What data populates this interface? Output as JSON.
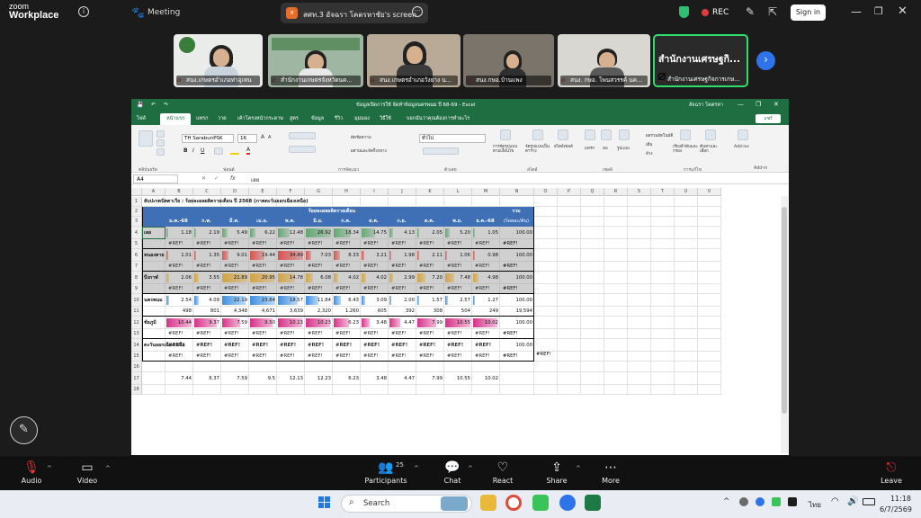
{
  "zoom": {
    "logo_line1": "zoom",
    "logo_line2": "Workplace",
    "meeting_label": "Meeting",
    "share_avatar": "ส",
    "share_label": "สศท.3 อัจฉรา โคตรหาชัย's screen",
    "rec_label": "REC",
    "signin_label": "Sign in",
    "participants": [
      {
        "name": "สนง.เกษตรอำเภอท่าอุเทน"
      },
      {
        "name": "สำนักงานเกษตรจังหวัดนค..."
      },
      {
        "name": "สนง.เกษตรอำเภอวังยาง น..."
      },
      {
        "name": "สนง.กษอ.บ้านแพง"
      },
      {
        "name": "สนง. กษอ. โพนสวรรค์ นค..."
      },
      {
        "name": "สำนักงานเศรษฐกิจการเกษ..."
      }
    ],
    "active_tile_title": "สำนักงานเศรษฐกิ...",
    "toolbar": {
      "audio": "Audio",
      "video": "Video",
      "participants": "Participants",
      "participants_count": "25",
      "chat": "Chat",
      "react": "React",
      "share": "Share",
      "more": "More",
      "leave": "Leave"
    }
  },
  "excel": {
    "title": "ข้อมูลเปิดการใช้ จัดทำข้อมูลนครพนม ปี 68-69 - Excel",
    "user": "อัจฉรา โคตรหา",
    "tabs": [
      "ไฟล์",
      "หน้าแรก",
      "แทรก",
      "วาด",
      "เค้าโครงหน้ากระดาษ",
      "สูตร",
      "ข้อมูล",
      "รีวิว",
      "มุมมอง",
      "วิธีใช้",
      "บอกฉันว่าคุณต้องการทำอะไร"
    ],
    "share_label": "แชร์",
    "ribbon": {
      "font_name": "TH SarabunPSK",
      "font_size": "16",
      "number_format": "ทั่วไป",
      "groups": [
        "คลิปบอร์ด",
        "ฟอนต์",
        "การจัดแนว",
        "ตัวเลข",
        "สไตล์",
        "เซลล์",
        "การแก้ไข",
        "Add-in"
      ],
      "wrap_text": "ตัดข้อความ",
      "merge_center": "ผสานและจัดกึ่งกลาง",
      "cond_format": "การจัดรูปแบบตามเงื่อนไข",
      "format_table": "จัดรูปแบบเป็นตาราง",
      "cell_styles": "สไตล์เซลล์",
      "insert": "แทรก",
      "delete": "ลบ",
      "format": "รูปแบบ",
      "autosum": "ผลรวมอัตโนมัติ",
      "fill": "เติม",
      "clear": "ล้าง",
      "sort_filter": "เรียงลำดับและกรอง",
      "find_select": "ค้นหาและเลือก",
      "addins": "Add-ins"
    },
    "name_box": "A4",
    "formula_value": "เลย",
    "columns": [
      "A",
      "B",
      "C",
      "D",
      "E",
      "F",
      "G",
      "H",
      "I",
      "J",
      "K",
      "L",
      "M",
      "N",
      "O",
      "P",
      "Q",
      "R",
      "S",
      "T",
      "U",
      "V"
    ],
    "sheet_title": "สับปะรดปัตตาเวีย : ร้อยละผลผลิตรายเดือน ปี 2568 (ภาคตะวันออกเฉียงเหนือ)",
    "header_main": "ร้อยละผลผลิตรายเดือน",
    "header_total": "รวม",
    "header_total_sub": "(ร้อยละ/ตัน)",
    "months": [
      "ม.ค.-68",
      "ก.พ.",
      "มี.ค.",
      "เม.ย.",
      "พ.ค.",
      "มิ.ย.",
      "ก.ค.",
      "ส.ค.",
      "ก.ย.",
      "ต.ค.",
      "พ.ย.",
      "ธ.ค.-68"
    ],
    "row_numbers": [
      "1",
      "2",
      "3",
      "4",
      "5",
      "6",
      "7",
      "8",
      "9",
      "10",
      "11",
      "12",
      "13",
      "14",
      "15",
      "16",
      "17",
      "18"
    ],
    "rows": [
      {
        "label": "เลย",
        "values": [
          "1.18",
          "2.19",
          "5.49",
          "6.22",
          "12.48",
          "26.92",
          "18.34",
          "14.75",
          "4.13",
          "2.05",
          "5.20",
          "1.05"
        ],
        "total": "100.00",
        "bar": [
          1.18,
          2.19,
          5.49,
          6.22,
          12.48,
          26.92,
          18.34,
          14.75,
          4.13,
          2.05,
          5.2,
          1.05
        ],
        "color": "#63a874"
      },
      {
        "label": "",
        "values": [
          "#REF!",
          "#REF!",
          "#REF!",
          "#REF!",
          "#REF!",
          "#REF!",
          "#REF!",
          "#REF!",
          "#REF!",
          "#REF!",
          "#REF!",
          "#REF!"
        ],
        "total": "#REF!"
      },
      {
        "label": "หนองคาย",
        "values": [
          "1.01",
          "1.35",
          "9.01",
          "19.44",
          "34.49",
          "7.03",
          "8.33",
          "3.21",
          "1.98",
          "2.11",
          "1.06",
          "0.98"
        ],
        "total": "100.00",
        "bar": [
          1.01,
          1.35,
          9.01,
          19.44,
          34.49,
          7.03,
          8.33,
          3.21,
          1.98,
          2.11,
          1.06,
          0.98
        ],
        "color": "#d9534f"
      },
      {
        "label": "",
        "values": [
          "#REF!",
          "#REF!",
          "#REF!",
          "#REF!",
          "#REF!",
          "#REF!",
          "#REF!",
          "#REF!",
          "#REF!",
          "#REF!",
          "#REF!",
          "#REF!"
        ],
        "total": "#REF!"
      },
      {
        "label": "บึงกาฬ",
        "values": [
          "2.06",
          "3.55",
          "21.89",
          "20.95",
          "14.78",
          "6.08",
          "4.02",
          "4.02",
          "2.99",
          "7.20",
          "7.48",
          "4.98"
        ],
        "total": "100.00",
        "bar": [
          2.06,
          3.55,
          21.89,
          20.95,
          14.78,
          6.08,
          4.02,
          4.02,
          2.99,
          7.2,
          7.48,
          4.98
        ],
        "color": "#d4a441"
      },
      {
        "label": "",
        "values": [
          "#REF!",
          "#REF!",
          "#REF!",
          "#REF!",
          "#REF!",
          "#REF!",
          "#REF!",
          "#REF!",
          "#REF!",
          "#REF!",
          "#REF!",
          "#REF!"
        ],
        "total": "#REF!"
      },
      {
        "label": "นครพนม",
        "values": [
          "2.54",
          "4.09",
          "22.19",
          "23.84",
          "18.57",
          "11.84",
          "6.43",
          "3.09",
          "2.00",
          "1.57",
          "2.57",
          "1.27"
        ],
        "total": "100.00",
        "bar": [
          2.54,
          4.09,
          22.19,
          23.84,
          18.57,
          11.84,
          6.43,
          3.09,
          2.0,
          1.57,
          2.57,
          1.27
        ],
        "color": "#3d8fe0"
      },
      {
        "label": "",
        "values": [
          "498",
          "801",
          "4,348",
          "4,671",
          "3,639",
          "2,320",
          "1,260",
          "605",
          "392",
          "308",
          "504",
          "249"
        ],
        "total": "19,594"
      },
      {
        "label": "ชัยภูมิ",
        "values": [
          "10.44",
          "9.37",
          "7.59",
          "9.50",
          "10.13",
          "10.23",
          "6.23",
          "3.48",
          "4.47",
          "7.99",
          "10.55",
          "10.02"
        ],
        "total": "100.00",
        "bar": [
          10.44,
          9.37,
          7.59,
          9.5,
          10.13,
          10.23,
          6.23,
          3.48,
          4.47,
          7.99,
          10.55,
          10.02
        ],
        "color": "#d6338a"
      },
      {
        "label": "",
        "values": [
          "#REF!",
          "#REF!",
          "#REF!",
          "#REF!",
          "#REF!",
          "#REF!",
          "#REF!",
          "#REF!",
          "#REF!",
          "#REF!",
          "#REF!",
          "#REF!"
        ],
        "total": "#REF!"
      },
      {
        "label": "ตะวันออกเฉียงเหนือ",
        "values": [
          "#REF!",
          "#REF!",
          "#REF!",
          "#REF!",
          "#REF!",
          "#REF!",
          "#REF!",
          "#REF!",
          "#REF!",
          "#REF!",
          "#REF!",
          "#REF!"
        ],
        "total": "100.00"
      },
      {
        "label": "",
        "values": [
          "#REF!",
          "#REF!",
          "#REF!",
          "#REF!",
          "#REF!",
          "#REF!",
          "#REF!",
          "#REF!",
          "#REF!",
          "#REF!",
          "#REF!",
          "#REF!"
        ],
        "total": "#REF!",
        "extra": "#REF!"
      }
    ],
    "row17": [
      "7.44",
      "8.37",
      "7.59",
      "9.5",
      "12.13",
      "12.23",
      "6.23",
      "3.48",
      "4.47",
      "7.99",
      "10.55",
      "10.02"
    ]
  },
  "taskbar": {
    "search_text": "Search",
    "lang": "ไทย",
    "time": "11:18",
    "date": "6/7/2569"
  }
}
